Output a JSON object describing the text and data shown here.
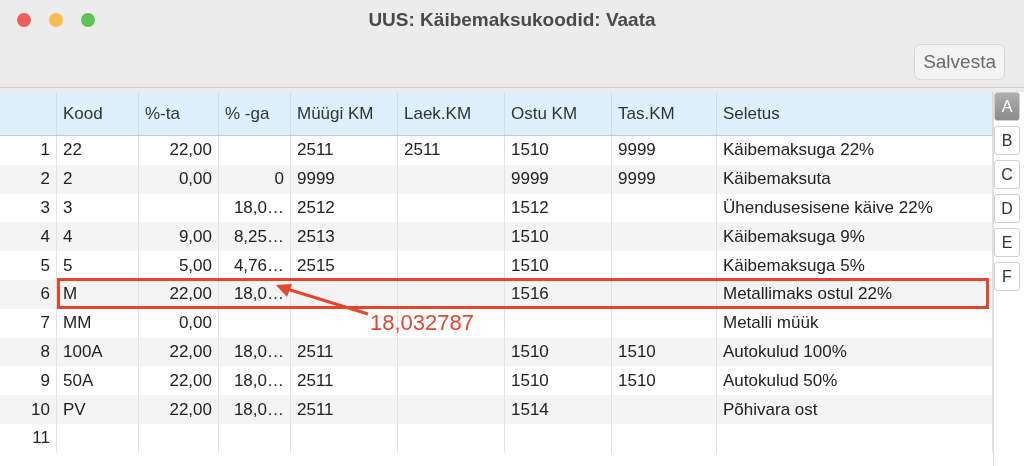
{
  "window": {
    "title": "UUS: Käibemaksukoodid: Vaata"
  },
  "toolbar": {
    "buttons": [
      "Salvesta"
    ]
  },
  "table": {
    "columns": [
      {
        "label": "Kood",
        "kind": "text"
      },
      {
        "label": "%-ta",
        "kind": "number"
      },
      {
        "label": "% -ga",
        "kind": "number"
      },
      {
        "label": "Müügi KM",
        "kind": "text"
      },
      {
        "label": "Laek.KM",
        "kind": "text"
      },
      {
        "label": "Ostu KM",
        "kind": "text"
      },
      {
        "label": "Tas.KM",
        "kind": "text"
      },
      {
        "label": "Seletus",
        "kind": "text"
      }
    ],
    "rows": [
      {
        "number": "1",
        "highlighted": false,
        "cells": [
          "22",
          "22,00",
          null,
          "2511",
          "2511",
          "1510",
          "9999",
          "Käibemaksuga 22%"
        ]
      },
      {
        "number": "2",
        "highlighted": false,
        "cells": [
          "2",
          "0,00",
          "0",
          "9999",
          null,
          "9999",
          "9999",
          "Käibemaksuta"
        ]
      },
      {
        "number": "3",
        "highlighted": false,
        "cells": [
          "3",
          null,
          "18,0…",
          "2512",
          null,
          "1512",
          null,
          "Ühendusesisene käive 22%"
        ]
      },
      {
        "number": "4",
        "highlighted": false,
        "cells": [
          "4",
          "9,00",
          "8,25…",
          "2513",
          null,
          "1510",
          null,
          "Käibemaksuga 9%"
        ]
      },
      {
        "number": "5",
        "highlighted": false,
        "cells": [
          "5",
          "5,00",
          "4,76…",
          "2515",
          null,
          "1510",
          null,
          "Käibemaksuga 5%"
        ]
      },
      {
        "number": "6",
        "highlighted": true,
        "cells": [
          "M",
          "22,00",
          "18,0…",
          null,
          null,
          "1516",
          null,
          "Metallimaks ostul 22%"
        ]
      },
      {
        "number": "7",
        "highlighted": false,
        "cells": [
          "MM",
          "0,00",
          null,
          null,
          null,
          null,
          null,
          "Metalli müük"
        ]
      },
      {
        "number": "8",
        "highlighted": false,
        "cells": [
          "100A",
          "22,00",
          "18,0…",
          "2511",
          null,
          "1510",
          "1510",
          "Autokulud 100%"
        ]
      },
      {
        "number": "9",
        "highlighted": false,
        "cells": [
          "50A",
          "22,00",
          "18,0…",
          "2511",
          null,
          "1510",
          "1510",
          "Autokulud 50%"
        ]
      },
      {
        "number": "10",
        "highlighted": false,
        "cells": [
          "PV",
          "22,00",
          "18,0…",
          "2511",
          null,
          "1514",
          null,
          "Põhivara ost"
        ]
      },
      {
        "number": "11",
        "highlighted": false,
        "cells": []
      }
    ]
  },
  "index_tabs": [
    {
      "label": "A",
      "selected": true
    },
    {
      "label": "B",
      "selected": false
    },
    {
      "label": "C",
      "selected": false
    },
    {
      "label": "D",
      "selected": false
    },
    {
      "label": "E",
      "selected": false
    },
    {
      "label": "F",
      "selected": false
    }
  ],
  "annotation": {
    "text": "18,032787"
  }
}
